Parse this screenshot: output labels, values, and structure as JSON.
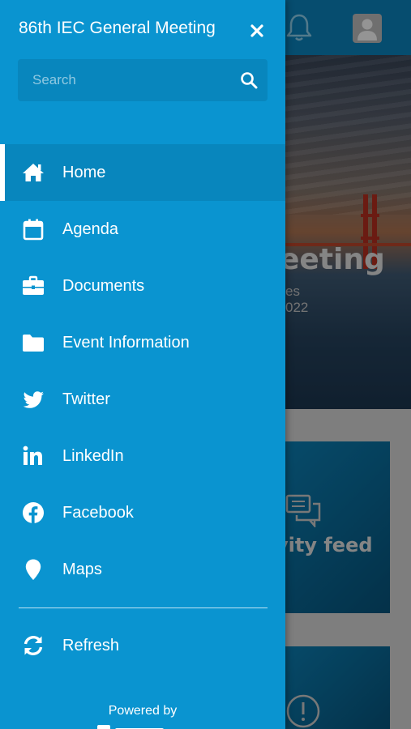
{
  "drawer": {
    "title": "86th IEC General Meeting",
    "search_placeholder": "Search",
    "items": [
      {
        "label": "Home",
        "icon": "home-icon",
        "active": true
      },
      {
        "label": "Agenda",
        "icon": "calendar-icon"
      },
      {
        "label": "Documents",
        "icon": "briefcase-icon"
      },
      {
        "label": "Event Information",
        "icon": "folder-icon"
      },
      {
        "label": "Twitter",
        "icon": "twitter-icon"
      },
      {
        "label": "LinkedIn",
        "icon": "linkedin-icon"
      },
      {
        "label": "Facebook",
        "icon": "facebook-icon"
      },
      {
        "label": "Maps",
        "icon": "map-pin-icon"
      }
    ],
    "refresh_label": "Refresh",
    "powered_by": "Powered by"
  },
  "background": {
    "hero_title_fragment": "eeting",
    "hero_sub1_fragment": "es",
    "hero_sub2_fragment": "022",
    "tile_label_fragment": "vity feed"
  },
  "colors": {
    "drawer": "#0a94d0",
    "active_item": "#0886bd",
    "header": "#0b86c0"
  }
}
